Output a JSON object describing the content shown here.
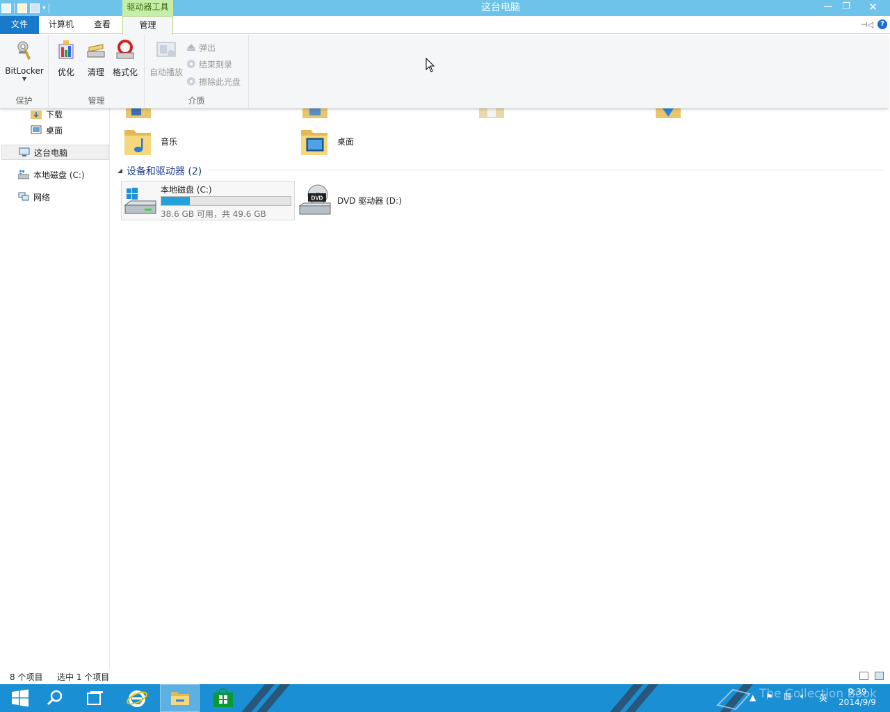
{
  "window": {
    "title": "这台电脑",
    "contextual_tab_group": "驱动器工具"
  },
  "ribbon_tabs": {
    "file": "文件",
    "computer": "计算机",
    "view": "查看",
    "manage": "管理"
  },
  "ribbon": {
    "groups": {
      "protect": "保护",
      "manage": "管理",
      "media": "介质"
    },
    "buttons": {
      "bitlocker": "BitLocker",
      "optimize": "优化",
      "cleanup": "清理",
      "format": "格式化",
      "autoplay": "自动播放",
      "eject": "弹出",
      "finish_burning": "结束刻录",
      "erase_disc": "擦除此光盘"
    }
  },
  "nav": {
    "items": [
      {
        "label": "下载"
      },
      {
        "label": "桌面"
      },
      {
        "label": "这台电脑"
      },
      {
        "label": "本地磁盘 (C:)"
      },
      {
        "label": "网络"
      }
    ]
  },
  "content": {
    "folders": [
      {
        "label": "音乐"
      },
      {
        "label": "桌面"
      }
    ],
    "devices_section": "设备和驱动器 (2)",
    "drive_c": {
      "name": "本地磁盘 (C:)",
      "space": "38.6 GB 可用，共 49.6 GB",
      "used_fraction": 0.22
    },
    "drive_d": {
      "name": "DVD 驱动器 (D:)",
      "badge": "DVD"
    }
  },
  "status": {
    "item_count": "8 个项目",
    "selected": "选中 1 个项目"
  },
  "taskbar": {
    "clock_time": "9:39",
    "clock_date": "2014/9/9",
    "ime": "英",
    "watermark": "The Collection Book"
  },
  "colors": {
    "titlebar": "#6ec3ea",
    "file_tab": "#1979ca",
    "contextual_tab": "#c6eea8",
    "taskbar": "#1b8fd4",
    "drive_bar": "#26a0da"
  }
}
